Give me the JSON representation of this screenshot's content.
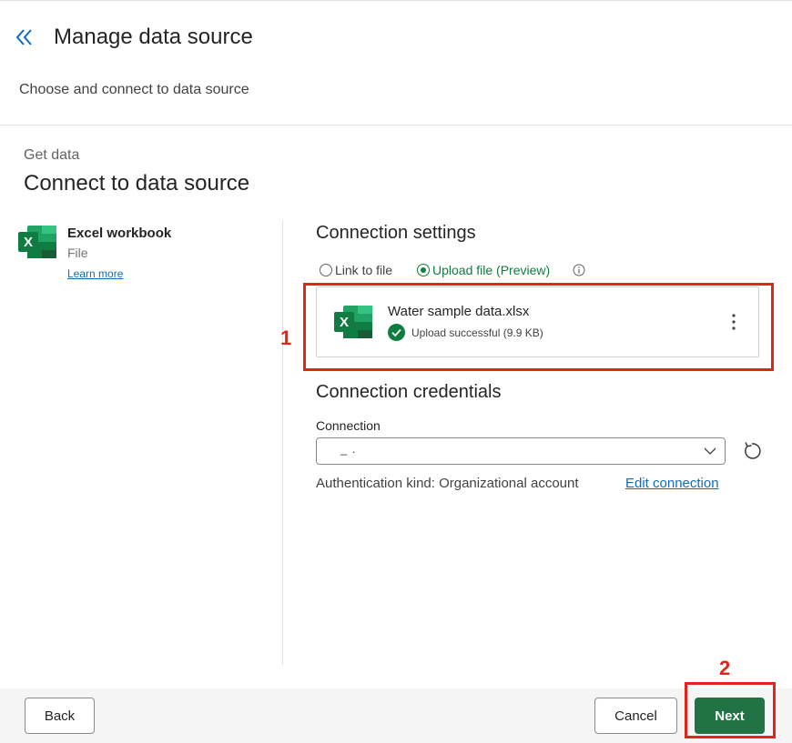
{
  "header": {
    "title": "Manage data source",
    "subtitle": "Choose and connect to data source"
  },
  "section": {
    "eyebrow": "Get data",
    "title": "Connect to data source"
  },
  "source": {
    "name": "Excel workbook",
    "type": "File",
    "learn_more": "Learn more",
    "icon": "excel-icon"
  },
  "connection_settings": {
    "title": "Connection settings",
    "options": [
      {
        "label": "Link to file",
        "selected": false
      },
      {
        "label": "Upload file (Preview)",
        "selected": true
      }
    ],
    "file": {
      "name": "Water sample data.xlsx",
      "status": "Upload successful (9.9 KB)"
    }
  },
  "connection_credentials": {
    "title": "Connection credentials",
    "connection_label": "Connection",
    "connection_value": "_                                              .",
    "auth_kind": "Authentication kind: Organizational account",
    "edit_connection": "Edit connection"
  },
  "annotations": [
    "1",
    "2"
  ],
  "footer": {
    "back": "Back",
    "cancel": "Cancel",
    "next": "Next"
  },
  "colors": {
    "accent_green": "#217346",
    "link_blue": "#0f6cbd",
    "annotation_red": "#e5231b"
  }
}
